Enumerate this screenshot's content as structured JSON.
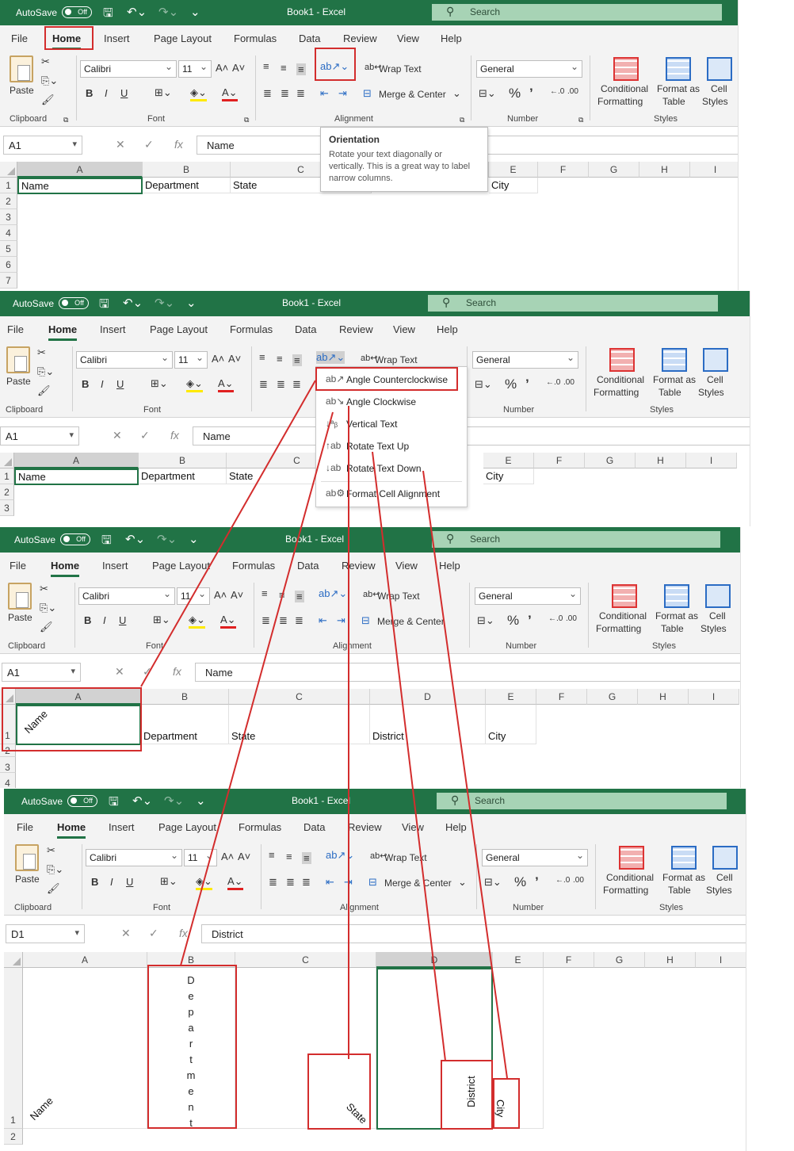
{
  "app": {
    "autosave_label": "AutoSave",
    "autosave_state": "Off",
    "title": "Book1  -  Excel",
    "search_placeholder": "Search"
  },
  "menu": [
    "File",
    "Home",
    "Insert",
    "Page Layout",
    "Formulas",
    "Data",
    "Review",
    "View",
    "Help"
  ],
  "ribbon": {
    "paste": "Paste",
    "clipboard": "Clipboard",
    "font_name": "Calibri",
    "font_size": "11",
    "font": "Font",
    "bold": "B",
    "italic": "I",
    "underline": "U",
    "wrap_text": "Wrap Text",
    "merge_center": "Merge & Center",
    "alignment": "Alignment",
    "number_format": "General",
    "number": "Number",
    "conditional_1": "Conditional",
    "conditional_2": "Formatting",
    "format_table_1": "Format as",
    "format_table_2": "Table",
    "cell_styles_1": "Cell",
    "cell_styles_2": "Styles",
    "styles": "Styles",
    "percent": "%",
    "comma": "’"
  },
  "tooltip": {
    "title": "Orientation",
    "body_1": "Rotate your text diagonally or",
    "body_2": "vertically. This is a great way to label",
    "body_3": "narrow columns."
  },
  "orientation_menu": [
    "Angle Counterclockwise",
    "Angle Clockwise",
    "Vertical Text",
    "Rotate Text Up",
    "Rotate Text Down",
    "Format Cell Alignment"
  ],
  "columns": [
    "A",
    "B",
    "C",
    "D",
    "E",
    "F",
    "G",
    "H",
    "I"
  ],
  "rows": [
    "1",
    "2",
    "3",
    "4",
    "5",
    "6",
    "7"
  ],
  "fx": "fx",
  "panel1": {
    "name_box": "A1",
    "formula": "Name",
    "cells": [
      "Name",
      "Department",
      "State",
      "City"
    ]
  },
  "panel2": {
    "name_box": "A1",
    "formula": "Name",
    "cells": [
      "Name",
      "Department",
      "State",
      "City"
    ]
  },
  "panel3": {
    "name_box": "A1",
    "formula": "Name",
    "cells": [
      "Name",
      "Department",
      "State",
      "District",
      "City"
    ]
  },
  "panel4": {
    "name_box": "D1",
    "formula": "District",
    "name": "Name",
    "department_letters": [
      "D",
      "e",
      "p",
      "a",
      "r",
      "t",
      "m",
      "e",
      "n",
      "t"
    ],
    "state": "State",
    "district": "District",
    "city": "City"
  },
  "colors": {
    "excel_green": "#217346",
    "annotation_red": "#d32d2d",
    "search_bg": "#a7d3b5"
  }
}
